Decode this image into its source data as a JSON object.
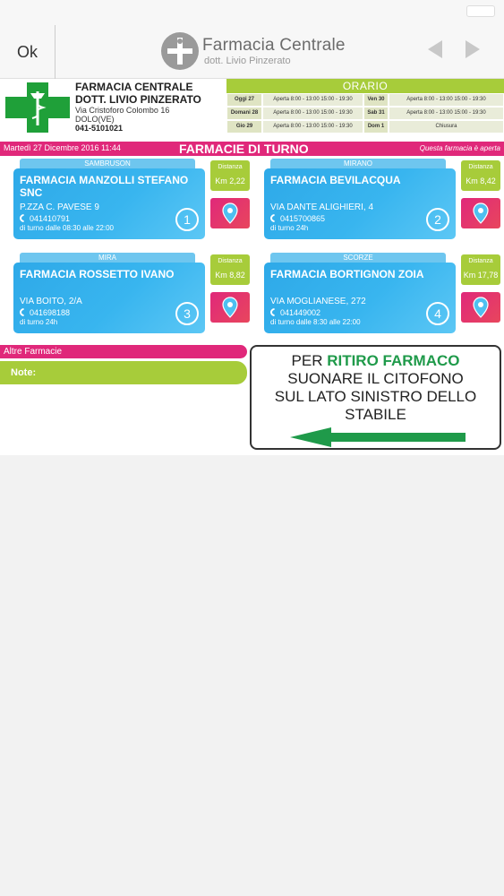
{
  "navbar": {
    "ok_label": "Ok",
    "brand_title": "Farmacia Centrale",
    "brand_subtitle": "dott. Livio Pinzerato"
  },
  "pharmacy": {
    "name": "FARMACIA CENTRALE",
    "doctor": "DOTT. LIVIO PINZERATO",
    "address": "Via Cristoforo Colombo 16",
    "city": "DOLO(VE)",
    "phone": "041-5101021"
  },
  "orario": {
    "title": "ORARIO",
    "rows": [
      {
        "day1": "Oggi 27",
        "hours1": "Aperta 8:00 - 13:00 15:00 - 19:30",
        "day2": "Ven 30",
        "hours2": "Aperta 8:00 - 13:00 15:00 - 19:30"
      },
      {
        "day1": "Domani 28",
        "hours1": "Aperta 8:00 - 13:00 15:00 - 19:30",
        "day2": "Sab 31",
        "hours2": "Aperta 8:00 - 13:00 15:00 - 19:30"
      },
      {
        "day1": "Gio 29",
        "hours1": "Aperta 8:00 - 13:00 15:00 - 19:30",
        "day2": "Dom 1",
        "hours2": "Chiusura"
      }
    ]
  },
  "turno": {
    "date": "Martedì 27 Dicembre 2016 11:44",
    "title": "FARMACIE DI TURNO",
    "status": "Questa farmacia è aperta"
  },
  "cards": [
    {
      "town": "SAMBRUSON",
      "name": "FARMACIA MANZOLLI STEFANO SNC",
      "address": "P.ZZA C. PAVESE 9",
      "phone": "041410791",
      "hours": "di turno dalle 08:30 alle 22:00",
      "number": "1",
      "distance_label": "Distanza",
      "distance": "Km 2,22"
    },
    {
      "town": "MIRANO",
      "name": "FARMACIA BEVILACQUA",
      "address": "VIA DANTE ALIGHIERI, 4",
      "phone": "0415700865",
      "hours": "di turno 24h",
      "number": "2",
      "distance_label": "Distanza",
      "distance": "Km 8,42"
    },
    {
      "town": "MIRA",
      "name": "FARMACIA ROSSETTO IVANO",
      "address": "VIA BOITO, 2/A",
      "phone": "041698188",
      "hours": "di turno 24h",
      "number": "3",
      "distance_label": "Distanza",
      "distance": "Km 8,82"
    },
    {
      "town": "SCORZE",
      "name": "FARMACIA BORTIGNON ZOIA",
      "address": "VIA MOGLIANESE, 272",
      "phone": "041449002",
      "hours": "di turno dalle 8:30 alle 22:00",
      "number": "4",
      "distance_label": "Distanza",
      "distance": "Km 17,78"
    }
  ],
  "altre": {
    "label": "Altre Farmacie"
  },
  "note": {
    "label": "Note:"
  },
  "ritiro": {
    "line1_prefix": "PER ",
    "line1_highlight": "RITIRO FARMACO",
    "line2": "SUONARE IL CITOFONO",
    "line3": "SUL LATO SINISTRO DELLO",
    "line4": "STABILE"
  },
  "colors": {
    "green": "#a7cc3a",
    "magenta": "#e0287a",
    "blue": "#2ea9e8",
    "cross_green": "#1fa039",
    "arrow_green": "#1f9a4a"
  }
}
